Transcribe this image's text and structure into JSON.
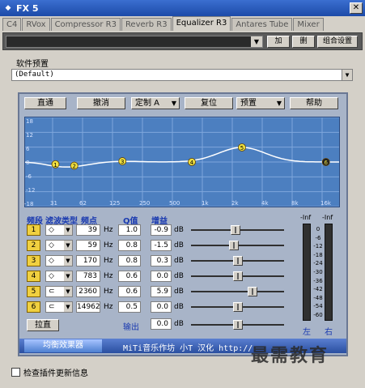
{
  "window": {
    "title": "FX 5"
  },
  "tabs": [
    "C4",
    "RVox",
    "Compressor R3",
    "Reverb R3",
    "Equalizer R3",
    "Antares Tube",
    "Mixer"
  ],
  "active_tab": 4,
  "toolbar": {
    "add_label": "加",
    "del_label": "删",
    "group_label": "组合设置"
  },
  "preset": {
    "label": "软件预置",
    "value": "(Default)"
  },
  "eq_buttons": {
    "direct": "直通",
    "undo": "撤消",
    "custom": "定制 A",
    "reset": "复位",
    "preset": "预置",
    "help": "帮助"
  },
  "graph": {
    "y_ticks": [
      "18",
      "12",
      "6",
      "0",
      "-6",
      "-12",
      "-18"
    ],
    "x_ticks": [
      "31",
      "62",
      "125",
      "250",
      "500",
      "1k",
      "2k",
      "4k",
      "8k",
      "16k"
    ],
    "points": [
      {
        "label": "1"
      },
      {
        "label": "2"
      },
      {
        "label": "3"
      },
      {
        "label": "4"
      },
      {
        "label": "5"
      },
      {
        "label": "6"
      }
    ]
  },
  "headers": {
    "band": "频段",
    "type": "滤波类型",
    "freq": "频点",
    "q": "Q值",
    "gain": "增益"
  },
  "bands": [
    {
      "num": "1",
      "freq": "39",
      "q": "1.0",
      "gain": "-0.9",
      "gain_value": -0.9
    },
    {
      "num": "2",
      "freq": "59",
      "q": "0.8",
      "gain": "-1.5",
      "gain_value": -1.5
    },
    {
      "num": "3",
      "freq": "170",
      "q": "0.8",
      "gain": "0.3",
      "gain_value": 0.3
    },
    {
      "num": "4",
      "freq": "783",
      "q": "0.6",
      "gain": "0.0",
      "gain_value": 0.0
    },
    {
      "num": "5",
      "freq": "2360",
      "q": "0.6",
      "gain": "5.9",
      "gain_value": 5.9
    },
    {
      "num": "6",
      "freq": "14962",
      "q": "0.5",
      "gain": "0.0",
      "gain_value": 0.0
    }
  ],
  "units": {
    "hz": "Hz",
    "db": "dB"
  },
  "output": {
    "button": "拉直",
    "label": "输出",
    "value": "0.0",
    "value_num": 0.0
  },
  "meters": {
    "top_left": "-Inf",
    "top_right": "-Inf",
    "scale": [
      "0",
      "-6",
      "-12",
      "-18",
      "-24",
      "-30",
      "-36",
      "-42",
      "-48",
      "-54",
      "-60"
    ],
    "left_label": "左",
    "right_label": "右"
  },
  "footer": {
    "tab_label": "均衡效果器",
    "credit": "MiTi音乐作坊 小T 汉化  http://",
    "watermark": "最需教育"
  },
  "update_check": {
    "label": "检查插件更新信息",
    "checked": false
  }
}
